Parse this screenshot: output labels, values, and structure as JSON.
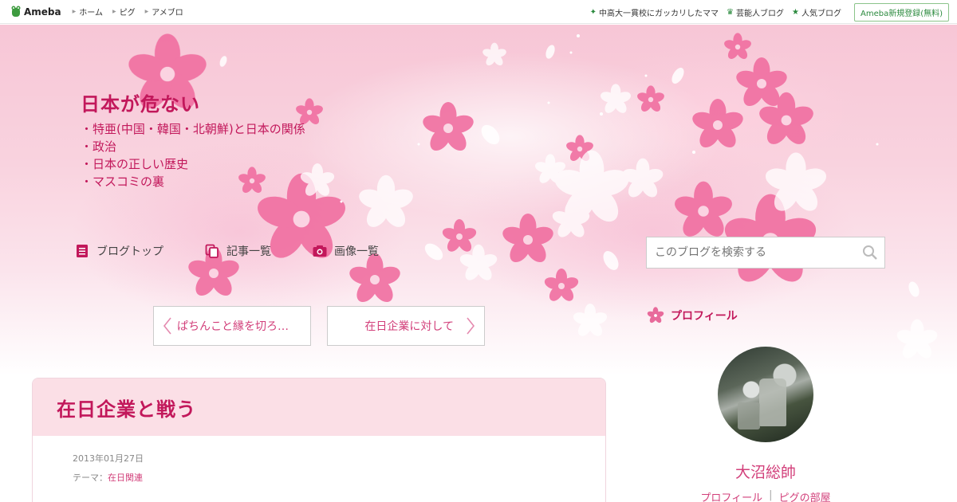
{
  "topbar": {
    "logo_text": "Ameba",
    "nav": [
      "ホーム",
      "ピグ",
      "アメブロ"
    ],
    "right_links": [
      {
        "label": "中高大一貫校にガッカリしたママ",
        "icon": "sparkle-icon"
      },
      {
        "label": "芸能人ブログ",
        "icon": "crown-icon"
      },
      {
        "label": "人気ブログ",
        "icon": "star-icon"
      }
    ],
    "signup_label": "Ameba新規登録(無料)"
  },
  "blog": {
    "title": "日本が危ない",
    "description": [
      "・特亜(中国・韓国・北朝鮮)と日本の関係",
      "・政治",
      "・日本の正しい歴史",
      "・マスコミの裏"
    ]
  },
  "blognav": [
    {
      "label": "ブログトップ",
      "icon": "document-icon"
    },
    {
      "label": "記事一覧",
      "icon": "copy-icon"
    },
    {
      "label": "画像一覧",
      "icon": "camera-icon"
    }
  ],
  "search": {
    "placeholder": "このブログを検索する"
  },
  "pager": {
    "prev_label": "ぱちんこと縁を切ろ…",
    "next_label": "在日企業に対して"
  },
  "profile": {
    "heading": "プロフィール",
    "name": "大沼総帥",
    "links": [
      "プロフィール",
      "ピグの部屋"
    ]
  },
  "article": {
    "title": "在日企業と戦う",
    "date": "2013年01月27日",
    "theme_prefix": "テーマ：",
    "theme": "在日関連"
  },
  "colors": {
    "accent": "#c2185b",
    "link": "#d23f7a",
    "green": "#2b8a3e",
    "article_head_bg": "#fbdfe6"
  }
}
